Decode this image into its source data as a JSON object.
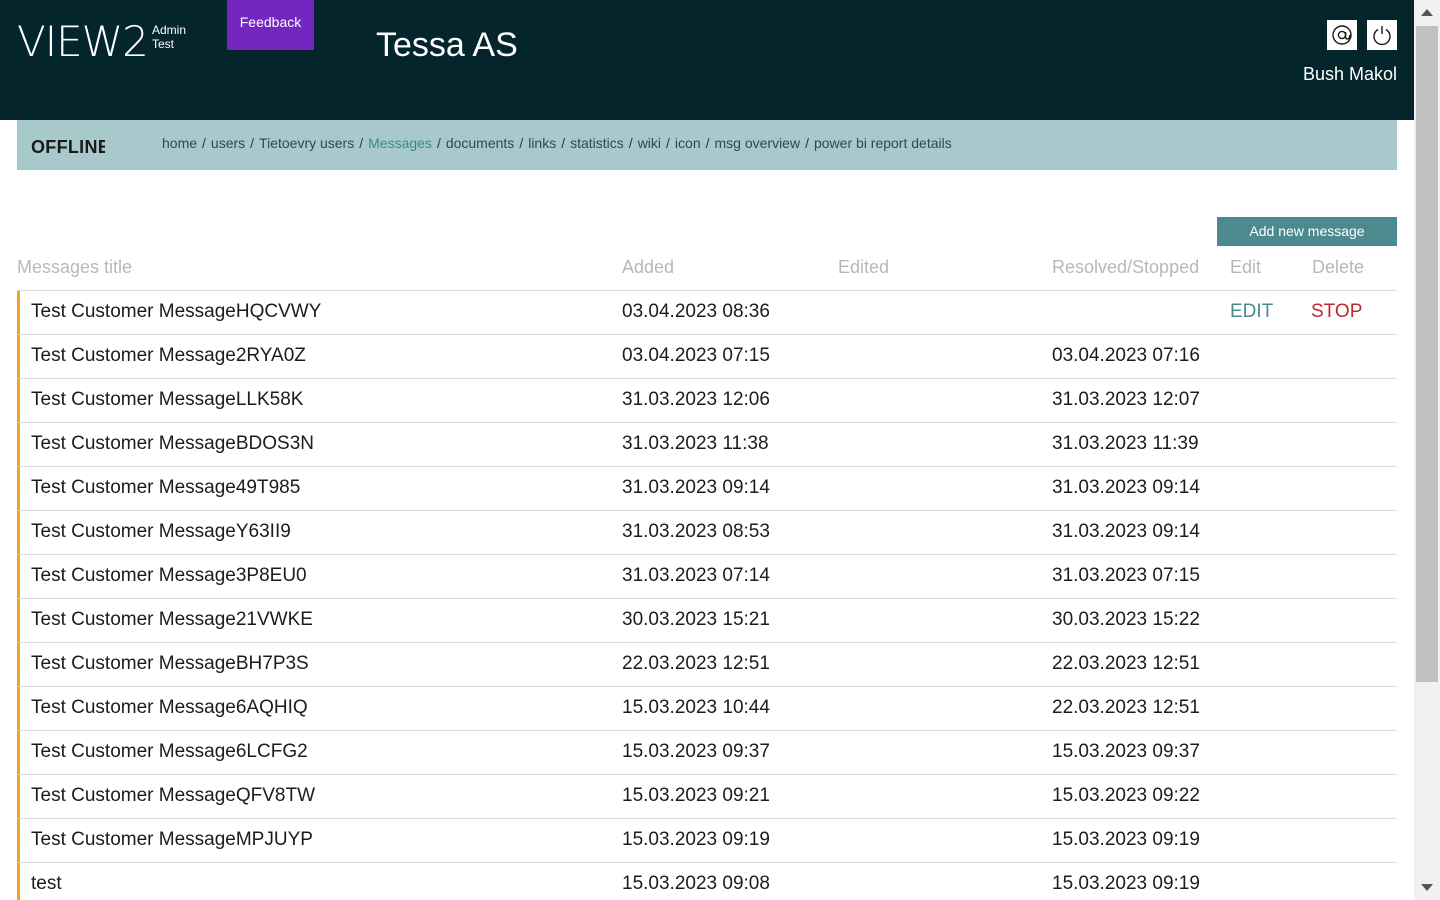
{
  "header": {
    "logo_text": "VIEW2",
    "logo_sub1": "Admin",
    "logo_sub2": "Test",
    "feedback_label": "Feedback",
    "company": "Tessa AS",
    "user_name": "Bush Makol",
    "icons": [
      "at-icon",
      "power-icon"
    ]
  },
  "nav": {
    "status": "OFFLINE",
    "breadcrumb": [
      "home",
      "users",
      "Tietoevry users",
      "Messages",
      "documents",
      "links",
      "statistics",
      "wiki",
      "icon",
      "msg overview",
      "power bi report details"
    ],
    "active": "Messages"
  },
  "actions": {
    "add_label": "Add new message"
  },
  "table": {
    "headers": {
      "title": "Messages title",
      "added": "Added",
      "edited": "Edited",
      "resolved": "Resolved/Stopped",
      "edit": "Edit",
      "delete": "Delete"
    },
    "rows": [
      {
        "title": "Test Customer MessageHQCVWY",
        "added": "03.04.2023 08:36",
        "edited": "",
        "resolved": "",
        "edit": "EDIT",
        "stop": "STOP"
      },
      {
        "title": "Test Customer Message2RYA0Z",
        "added": "03.04.2023 07:15",
        "edited": "",
        "resolved": "03.04.2023 07:16",
        "edit": "",
        "stop": ""
      },
      {
        "title": "Test Customer MessageLLK58K",
        "added": "31.03.2023 12:06",
        "edited": "",
        "resolved": "31.03.2023 12:07",
        "edit": "",
        "stop": ""
      },
      {
        "title": "Test Customer MessageBDOS3N",
        "added": "31.03.2023 11:38",
        "edited": "",
        "resolved": "31.03.2023 11:39",
        "edit": "",
        "stop": ""
      },
      {
        "title": "Test Customer Message49T985",
        "added": "31.03.2023 09:14",
        "edited": "",
        "resolved": "31.03.2023 09:14",
        "edit": "",
        "stop": ""
      },
      {
        "title": "Test Customer MessageY63II9",
        "added": "31.03.2023 08:53",
        "edited": "",
        "resolved": "31.03.2023 09:14",
        "edit": "",
        "stop": ""
      },
      {
        "title": "Test Customer Message3P8EU0",
        "added": "31.03.2023 07:14",
        "edited": "",
        "resolved": "31.03.2023 07:15",
        "edit": "",
        "stop": ""
      },
      {
        "title": "Test Customer Message21VWKE",
        "added": "30.03.2023 15:21",
        "edited": "",
        "resolved": "30.03.2023 15:22",
        "edit": "",
        "stop": ""
      },
      {
        "title": "Test Customer MessageBH7P3S",
        "added": "22.03.2023 12:51",
        "edited": "",
        "resolved": "22.03.2023 12:51",
        "edit": "",
        "stop": ""
      },
      {
        "title": "Test Customer Message6AQHIQ",
        "added": "15.03.2023 10:44",
        "edited": "",
        "resolved": "22.03.2023 12:51",
        "edit": "",
        "stop": ""
      },
      {
        "title": "Test Customer Message6LCFG2",
        "added": "15.03.2023 09:37",
        "edited": "",
        "resolved": "15.03.2023 09:37",
        "edit": "",
        "stop": ""
      },
      {
        "title": "Test Customer MessageQFV8TW",
        "added": "15.03.2023 09:21",
        "edited": "",
        "resolved": "15.03.2023 09:22",
        "edit": "",
        "stop": ""
      },
      {
        "title": "Test Customer MessageMPJUYP",
        "added": "15.03.2023 09:19",
        "edited": "",
        "resolved": "15.03.2023 09:19",
        "edit": "",
        "stop": ""
      },
      {
        "title": "test",
        "added": "15.03.2023 09:08",
        "edited": "",
        "resolved": "15.03.2023 09:19",
        "edit": "",
        "stop": ""
      }
    ]
  },
  "colors": {
    "header_bg": "#04252c",
    "feedback_bg": "#7426c1",
    "nav_bg": "#a8c9cc",
    "accent": "#4d8a8e",
    "row_marker": "#f1a325",
    "stop": "#c0282e"
  }
}
